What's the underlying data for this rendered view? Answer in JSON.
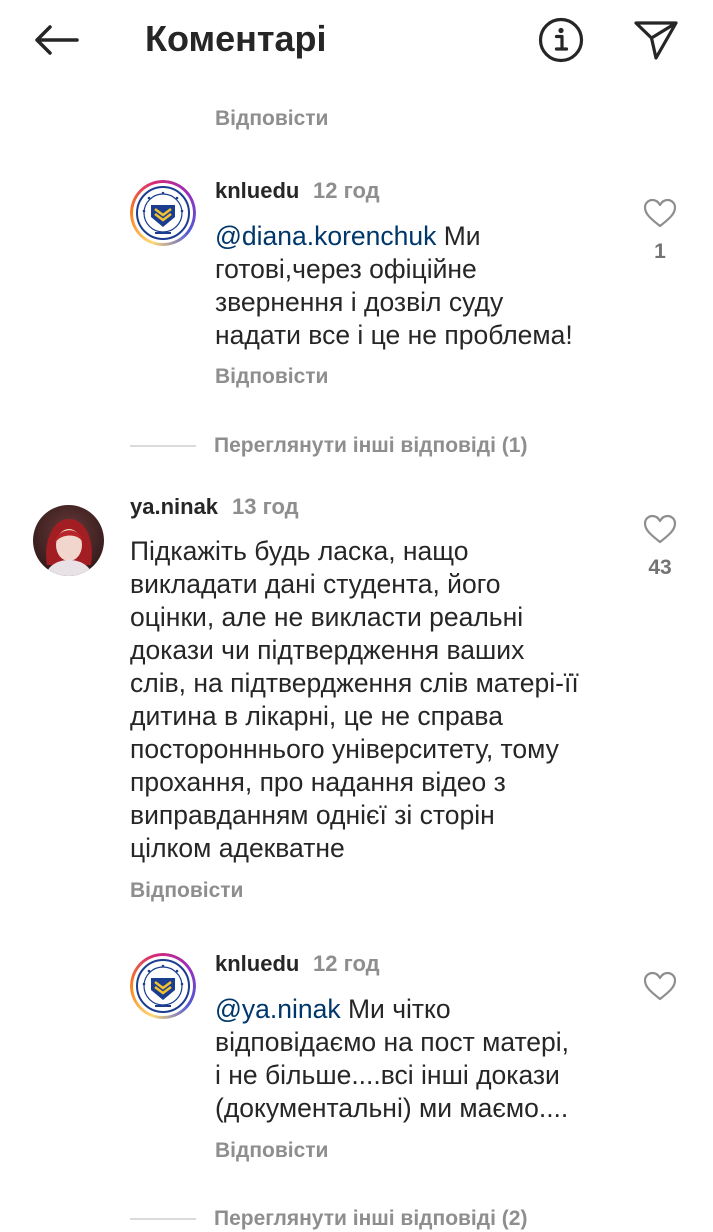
{
  "header": {
    "title": "Коментарі",
    "back_icon": "arrow-left-icon",
    "info_icon": "info-icon",
    "send_icon": "send-icon"
  },
  "top_reply": {
    "reply_label": "Відповісти"
  },
  "comments": [
    {
      "username": "knluedu",
      "time": "12 год",
      "mention": "@diana.korenchuk",
      "text": " Ми\nготові,через офіційне\nзвернення і дозвіл суду\nнадати все і це не проблема!",
      "reply_label": "Відповісти",
      "likes": "1",
      "avatar": "university-logo-avatar"
    },
    {
      "view_more": "Переглянути інші відповіді (1)"
    },
    {
      "username": "ya.ninak",
      "time": "13 год",
      "text": "Підкажіть будь ласка, нащо\nвикладати дані студента, його\nоцінки, але не викласти реальні\nдокази чи підтвердження ваших\nслів, на підтвердження слів матері-її\nдитина в лікарні, це не справа\nпосторонннього університету, тому\nпрохання, про надання відео з\nвиправданням однієї зі сторін\nцілком адекватне",
      "reply_label": "Відповісти",
      "likes": "43",
      "avatar": "user-photo-avatar"
    },
    {
      "username": "knluedu",
      "time": "12 год",
      "mention": "@ya.ninak",
      "text": " Ми чітко\nвідповідаємо на пост матері,\nі не більше....всі інші докази\n(документальні) ми маємо....",
      "reply_label": "Відповісти",
      "likes": "",
      "avatar": "university-logo-avatar"
    },
    {
      "view_more": "Переглянути інші відповіді (2)"
    }
  ],
  "colors": {
    "text": "#262626",
    "muted": "#8e8e8e",
    "mention": "#00376b",
    "divider": "#dbdbdb"
  }
}
